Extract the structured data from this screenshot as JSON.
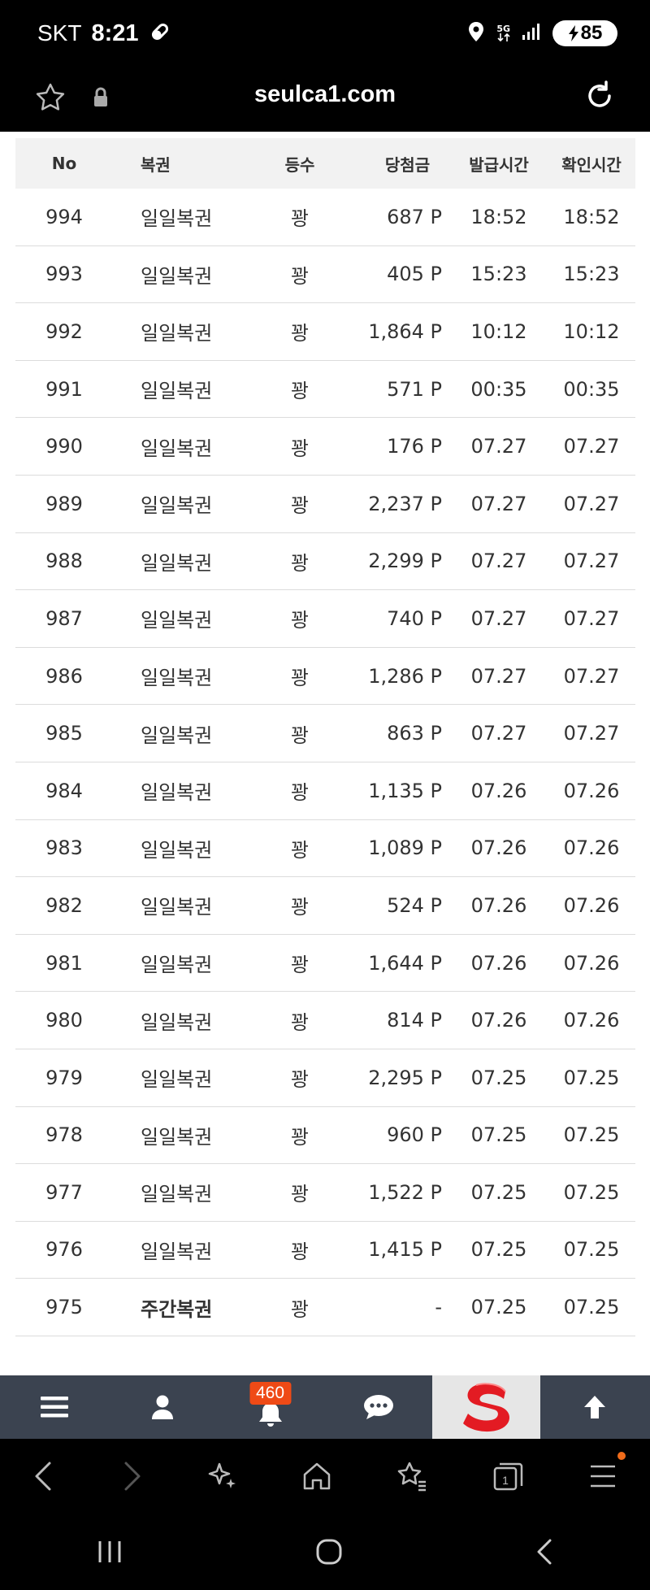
{
  "status": {
    "carrier": "SKT",
    "time": "8:21",
    "network": "5G",
    "battery": "85"
  },
  "address": {
    "url": "seulca1.com"
  },
  "table": {
    "headers": [
      "No",
      "복권",
      "등수",
      "당첨금",
      "발급시간",
      "확인시간"
    ],
    "rows": [
      {
        "no": "994",
        "name": "일일복권",
        "rank": "꽝",
        "prize": "687 P",
        "issued": "18:52",
        "checked": "18:52"
      },
      {
        "no": "993",
        "name": "일일복권",
        "rank": "꽝",
        "prize": "405 P",
        "issued": "15:23",
        "checked": "15:23"
      },
      {
        "no": "992",
        "name": "일일복권",
        "rank": "꽝",
        "prize": "1,864 P",
        "issued": "10:12",
        "checked": "10:12"
      },
      {
        "no": "991",
        "name": "일일복권",
        "rank": "꽝",
        "prize": "571 P",
        "issued": "00:35",
        "checked": "00:35"
      },
      {
        "no": "990",
        "name": "일일복권",
        "rank": "꽝",
        "prize": "176 P",
        "issued": "07.27",
        "checked": "07.27"
      },
      {
        "no": "989",
        "name": "일일복권",
        "rank": "꽝",
        "prize": "2,237 P",
        "issued": "07.27",
        "checked": "07.27"
      },
      {
        "no": "988",
        "name": "일일복권",
        "rank": "꽝",
        "prize": "2,299 P",
        "issued": "07.27",
        "checked": "07.27"
      },
      {
        "no": "987",
        "name": "일일복권",
        "rank": "꽝",
        "prize": "740 P",
        "issued": "07.27",
        "checked": "07.27"
      },
      {
        "no": "986",
        "name": "일일복권",
        "rank": "꽝",
        "prize": "1,286 P",
        "issued": "07.27",
        "checked": "07.27"
      },
      {
        "no": "985",
        "name": "일일복권",
        "rank": "꽝",
        "prize": "863 P",
        "issued": "07.27",
        "checked": "07.27"
      },
      {
        "no": "984",
        "name": "일일복권",
        "rank": "꽝",
        "prize": "1,135 P",
        "issued": "07.26",
        "checked": "07.26"
      },
      {
        "no": "983",
        "name": "일일복권",
        "rank": "꽝",
        "prize": "1,089 P",
        "issued": "07.26",
        "checked": "07.26"
      },
      {
        "no": "982",
        "name": "일일복권",
        "rank": "꽝",
        "prize": "524 P",
        "issued": "07.26",
        "checked": "07.26"
      },
      {
        "no": "981",
        "name": "일일복권",
        "rank": "꽝",
        "prize": "1,644 P",
        "issued": "07.26",
        "checked": "07.26"
      },
      {
        "no": "980",
        "name": "일일복권",
        "rank": "꽝",
        "prize": "814 P",
        "issued": "07.26",
        "checked": "07.26"
      },
      {
        "no": "979",
        "name": "일일복권",
        "rank": "꽝",
        "prize": "2,295 P",
        "issued": "07.25",
        "checked": "07.25"
      },
      {
        "no": "978",
        "name": "일일복권",
        "rank": "꽝",
        "prize": "960 P",
        "issued": "07.25",
        "checked": "07.25"
      },
      {
        "no": "977",
        "name": "일일복권",
        "rank": "꽝",
        "prize": "1,522 P",
        "issued": "07.25",
        "checked": "07.25"
      },
      {
        "no": "976",
        "name": "일일복권",
        "rank": "꽝",
        "prize": "1,415 P",
        "issued": "07.25",
        "checked": "07.25"
      },
      {
        "no": "975",
        "name": "주간복권",
        "rank": "꽝",
        "prize": "-",
        "issued": "07.25",
        "checked": "07.25",
        "bold": true
      }
    ]
  },
  "site_nav": {
    "notification_count": "460",
    "items": [
      "menu-icon",
      "user-icon",
      "bell-icon",
      "chat-icon",
      "logo-s",
      "arrow-up-icon"
    ]
  },
  "colors": {
    "nav_bg": "#3b4350",
    "badge": "#ef4a16",
    "accent_dot": "#ef6b1a"
  }
}
